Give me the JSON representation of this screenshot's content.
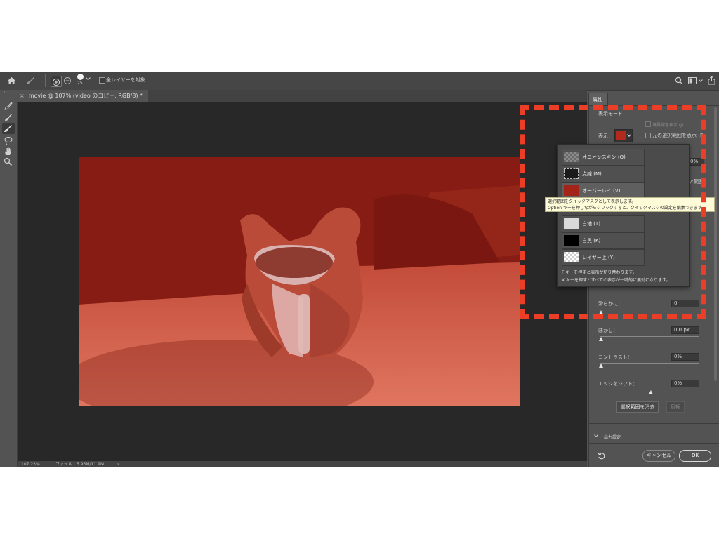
{
  "options_bar": {
    "brush_size": "25",
    "sample_all_layers": "全レイヤーを対象"
  },
  "document_tab": {
    "close": "×",
    "title": "movie @ 107% (video のコピー, RGB/8) *"
  },
  "status_bar": {
    "zoom": "107.23%",
    "file_info": "ファイル：5.93M/11.9M"
  },
  "panel": {
    "tab": "属性",
    "view_mode_heading": "表示モード",
    "view_label": "表示：",
    "show_edge": "境界線を表示 (J)",
    "show_original": "元の選択範囲を表示 (P)",
    "partial_value": "0%",
    "partial_label": "ア範囲",
    "smooth_label": "滑らかに：",
    "smooth_value": "0",
    "feather_label": "ぼかし：",
    "feather_value": "0.0 px",
    "contrast_label": "コントラスト：",
    "contrast_value": "0%",
    "shift_edge_label": "エッジをシフト：",
    "shift_edge_value": "0%",
    "clear_selection": "選択範囲を消去",
    "invert": "反転",
    "output_settings": "出力設定",
    "cancel": "キャンセル",
    "ok": "OK"
  },
  "view_popup": {
    "items": [
      {
        "label": "オニオンスキン (O)"
      },
      {
        "label": "点線 (M)"
      },
      {
        "label": "オーバーレイ (V)"
      },
      {
        "label": "白地 (T)"
      },
      {
        "label": "白黒 (K)"
      },
      {
        "label": "レイヤー上 (Y)"
      }
    ],
    "hint_f": "F キーを押すと表示が切り替わります。",
    "hint_x": "X キーを押すとすべての表示が一時的に無効になります。"
  },
  "tooltip": {
    "line1": "選択範囲をクイックマスクとして表示します。",
    "line2": "Option キーを押しながらクリックすると、クイックマスクの設定を編集できます。"
  },
  "colors": {
    "overlay_red": "#8c2016",
    "highlight_dash": "#ec3d26",
    "tooltip_bg": "#fdfbd8"
  }
}
